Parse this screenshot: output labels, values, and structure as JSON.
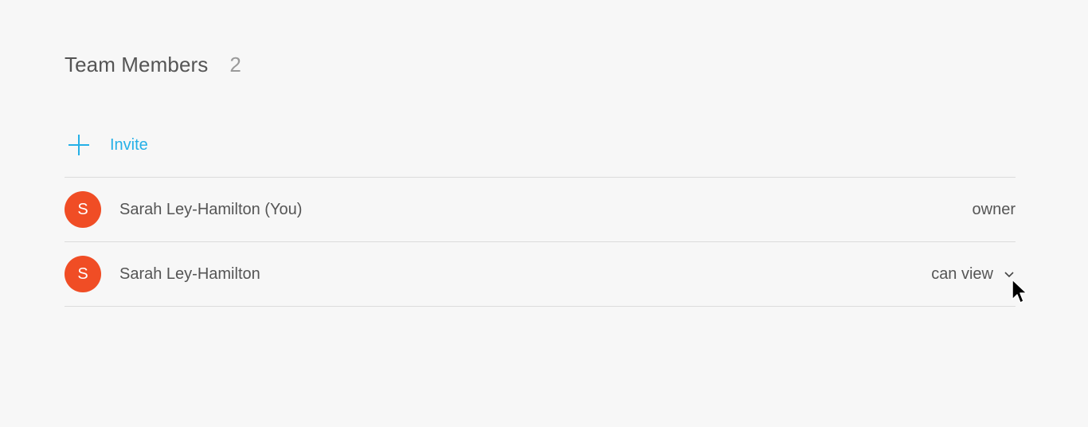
{
  "header": {
    "title": "Team Members",
    "count": "2"
  },
  "invite": {
    "label": "Invite",
    "icon": "plus-icon"
  },
  "members": [
    {
      "initial": "S",
      "name": "Sarah Ley-Hamilton (You)",
      "role": "owner",
      "editable": false
    },
    {
      "initial": "S",
      "name": "Sarah Ley-Hamilton",
      "role": "can view",
      "editable": true
    }
  ],
  "colors": {
    "accent": "#25b0e7",
    "avatar": "#f04d25",
    "background": "#f7f7f7"
  }
}
